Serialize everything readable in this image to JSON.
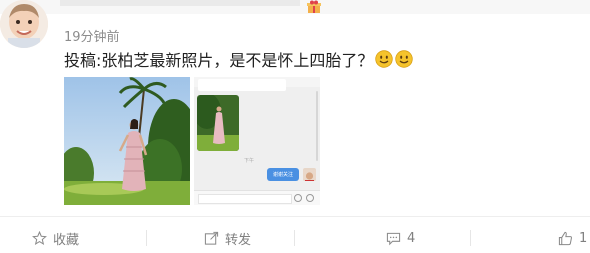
{
  "post": {
    "timestamp": "19分钟前",
    "text": "投稿:张柏芝最新照片，是不是怀上四胎了？"
  },
  "chat_screenshot": {
    "outgoing_message": "谢谢关注",
    "time_label": "下午"
  },
  "actions": {
    "favorite_label": "收藏",
    "repost_label": "转发",
    "comment_count": "4",
    "like_count": "1"
  },
  "icons": {
    "favorite": "star-icon",
    "repost": "share-icon",
    "comment": "comment-icon",
    "like": "thumb-up-icon",
    "emoji": "smile-emoji-icon"
  },
  "colors": {
    "accent_blue": "#4a90e2",
    "meta_gray": "#8c8c8c",
    "emoji_yellow": "#f5c32c"
  }
}
